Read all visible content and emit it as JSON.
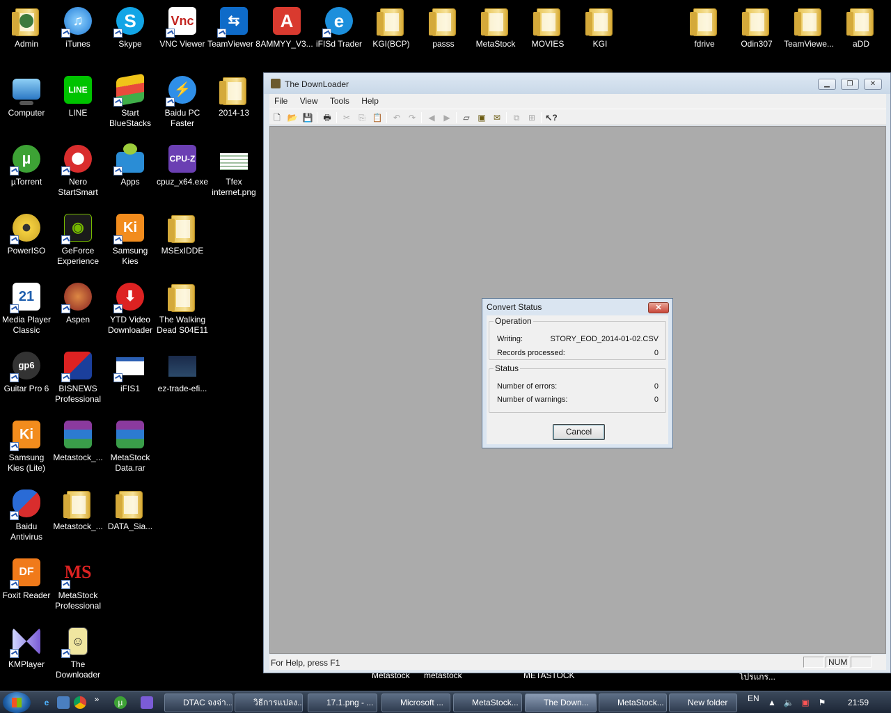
{
  "desktop": {
    "icons": [
      {
        "label": "Admin"
      },
      {
        "label": "iTunes"
      },
      {
        "label": "Skype"
      },
      {
        "label": "VNC Viewer"
      },
      {
        "label": "TeamViewer 8"
      },
      {
        "label": "AMMYY_V3..."
      },
      {
        "label": "iFISd Trader"
      },
      {
        "label": "KGI(BCP)"
      },
      {
        "label": "passs"
      },
      {
        "label": "MetaStock"
      },
      {
        "label": "MOVIES"
      },
      {
        "label": "KGI"
      },
      {
        "label": "fdrive"
      },
      {
        "label": "Odin307"
      },
      {
        "label": "TeamViewe..."
      },
      {
        "label": "aDD"
      },
      {
        "label": "Computer"
      },
      {
        "label": "LINE"
      },
      {
        "label": "Start BlueStacks"
      },
      {
        "label": "Baidu PC Faster"
      },
      {
        "label": "2014-13"
      },
      {
        "label": "µTorrent"
      },
      {
        "label": "Nero StartSmart"
      },
      {
        "label": "Apps"
      },
      {
        "label": "cpuz_x64.exe"
      },
      {
        "label": "Tfex internet.png"
      },
      {
        "label": "PowerISO"
      },
      {
        "label": "GeForce Experience"
      },
      {
        "label": "Samsung Kies"
      },
      {
        "label": "MSExIDDE"
      },
      {
        "label": "Media Player Classic"
      },
      {
        "label": "Aspen"
      },
      {
        "label": "YTD Video Downloader"
      },
      {
        "label": "The Walking Dead S04E11"
      },
      {
        "label": "Guitar Pro 6"
      },
      {
        "label": "BISNEWS Professional"
      },
      {
        "label": "iFIS1"
      },
      {
        "label": "ez-trade-efi..."
      },
      {
        "label": "Samsung Kies (Lite)"
      },
      {
        "label": "Metastock_..."
      },
      {
        "label": "MetaStock Data.rar"
      },
      {
        "label": "Baidu Antivirus"
      },
      {
        "label": "Metastock_..."
      },
      {
        "label": "DATA_Sia..."
      },
      {
        "label": "Foxit Reader"
      },
      {
        "label": "MetaStock Professional"
      },
      {
        "label": "KMPlayer"
      },
      {
        "label": "The Downloader"
      }
    ],
    "under_labels": [
      "Metastock",
      "metastock",
      "METASTOCK",
      "โปรแกร..."
    ]
  },
  "window": {
    "title": "The DownLoader",
    "menu": [
      "File",
      "View",
      "Tools",
      "Help"
    ],
    "status_message": "For Help, press F1",
    "status_num": "NUM"
  },
  "dialog": {
    "title": "Convert Status",
    "close": "✕",
    "operation_label": "Operation",
    "writing_label": "Writing:",
    "writing_value": "STORY_EOD_2014-01-02.CSV",
    "records_label": "Records processed:",
    "records_value": "0",
    "status_label": "Status",
    "errors_label": "Number of errors:",
    "errors_value": "0",
    "warnings_label": "Number of warnings:",
    "warnings_value": "0",
    "cancel_label": "Cancel"
  },
  "taskbar": {
    "overflow": "»",
    "buttons": [
      {
        "label": "DTAC จงจ่า..."
      },
      {
        "label": "วิธีการแปลง..."
      },
      {
        "label": "17.1.png - ..."
      },
      {
        "label": "Microsoft ..."
      },
      {
        "label": "MetaStock..."
      },
      {
        "label": "The Down..."
      },
      {
        "label": "MetaStock..."
      },
      {
        "label": "New folder"
      }
    ],
    "language": "EN",
    "clock": "21:59"
  }
}
